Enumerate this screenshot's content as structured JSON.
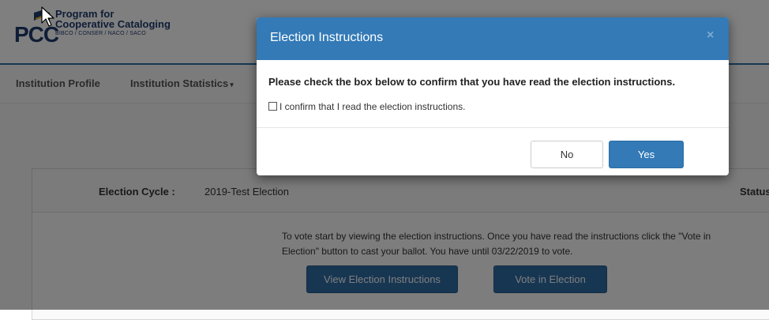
{
  "header": {
    "logo": {
      "acronym": "PCC",
      "line1": "Program for",
      "line2": "Cooperative Cataloging",
      "line3": "BIBCO / CONSER / NACO / SACO"
    }
  },
  "nav": {
    "items": [
      {
        "label": "Institution Profile"
      },
      {
        "label": "Institution Statistics"
      }
    ],
    "caret": "▾"
  },
  "election": {
    "cycle_label": "Election Cycle :",
    "cycle_value": "2019-Test Election",
    "status_label": "Status",
    "instructions_text": "To vote start by viewing the election instructions. Once you have read the instructions click the \"Vote in Election\" button to cast your ballot. You have until 03/22/2019 to vote.",
    "view_instructions_label": "View Election Instructions",
    "vote_label": "Vote in Election"
  },
  "modal": {
    "title": "Election Instructions",
    "close_glyph": "×",
    "body_text": "Please check the box below to confirm that you have read the election instructions.",
    "confirm_label": "I confirm that I read the election instructions.",
    "confirm_checked": false,
    "no_label": "No",
    "yes_label": "Yes"
  },
  "colors": {
    "modal_header": "#337ab7",
    "primary_button": "#337ab7",
    "brand_navy": "#1f3b6e"
  }
}
